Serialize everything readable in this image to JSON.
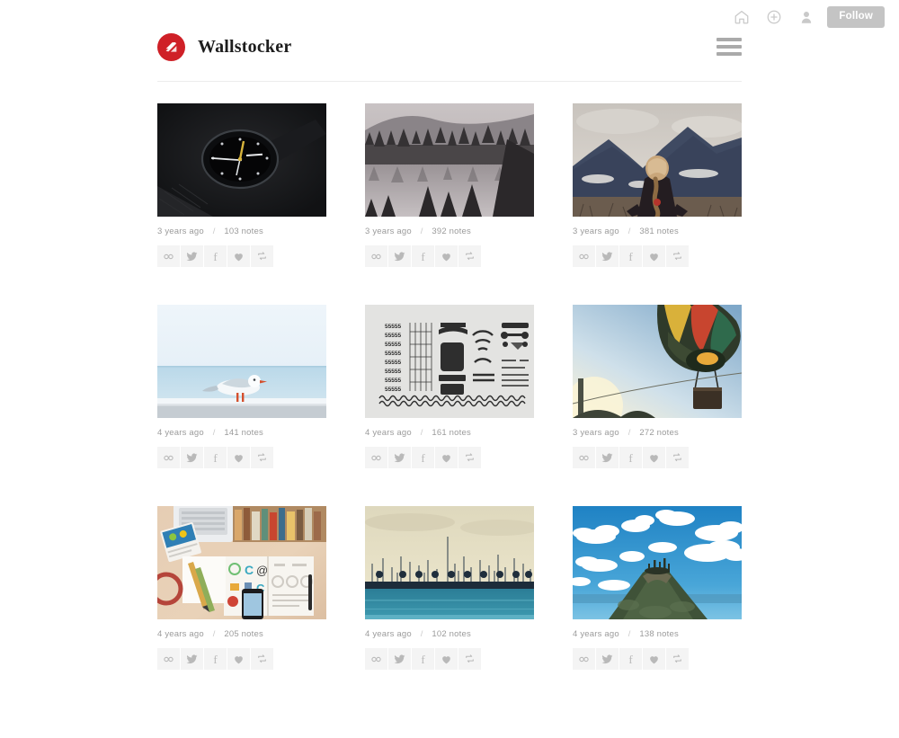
{
  "topbar": {
    "icons": [
      {
        "name": "home-icon",
        "label": "Home"
      },
      {
        "name": "plus-circle-icon",
        "label": "New post"
      },
      {
        "name": "user-icon",
        "label": "Account"
      }
    ],
    "follow_label": "Follow"
  },
  "masthead": {
    "logo_name": "wallstocker-logo-icon",
    "logo_color": "#cf2027",
    "title": "Wallstocker",
    "menu_name": "hamburger-menu-icon"
  },
  "actions": [
    {
      "name": "permalink-icon",
      "label": "Permalink"
    },
    {
      "name": "twitter-icon",
      "label": "Tweet"
    },
    {
      "name": "facebook-icon",
      "label": "Share on Facebook"
    },
    {
      "name": "heart-icon",
      "label": "Like"
    },
    {
      "name": "reblog-icon",
      "label": "Reblog"
    }
  ],
  "posts": [
    {
      "image": "watch-on-dark-surface",
      "age": "3 years ago",
      "notes": "103 notes",
      "separator": "/"
    },
    {
      "image": "misty-lake-forest",
      "age": "3 years ago",
      "notes": "392 notes",
      "separator": "/"
    },
    {
      "image": "person-braid-mountains",
      "age": "3 years ago",
      "notes": "381 notes",
      "separator": "/"
    },
    {
      "image": "seagull-on-railing-sea",
      "age": "4 years ago",
      "notes": "141 notes",
      "separator": "/"
    },
    {
      "image": "flatlay-black-shapes-grid",
      "age": "4 years ago",
      "notes": "161 notes",
      "separator": "/"
    },
    {
      "image": "hot-air-balloon-sunset",
      "age": "3 years ago",
      "notes": "272 notes",
      "separator": "/"
    },
    {
      "image": "desk-flatlay-laptop-books",
      "age": "4 years ago",
      "notes": "205 notes",
      "separator": "/"
    },
    {
      "image": "harbor-sailboat-masts",
      "age": "4 years ago",
      "notes": "102 notes",
      "separator": "/"
    },
    {
      "image": "rocky-peak-blue-sky-clouds",
      "age": "4 years ago",
      "notes": "138 notes",
      "separator": "/"
    }
  ]
}
